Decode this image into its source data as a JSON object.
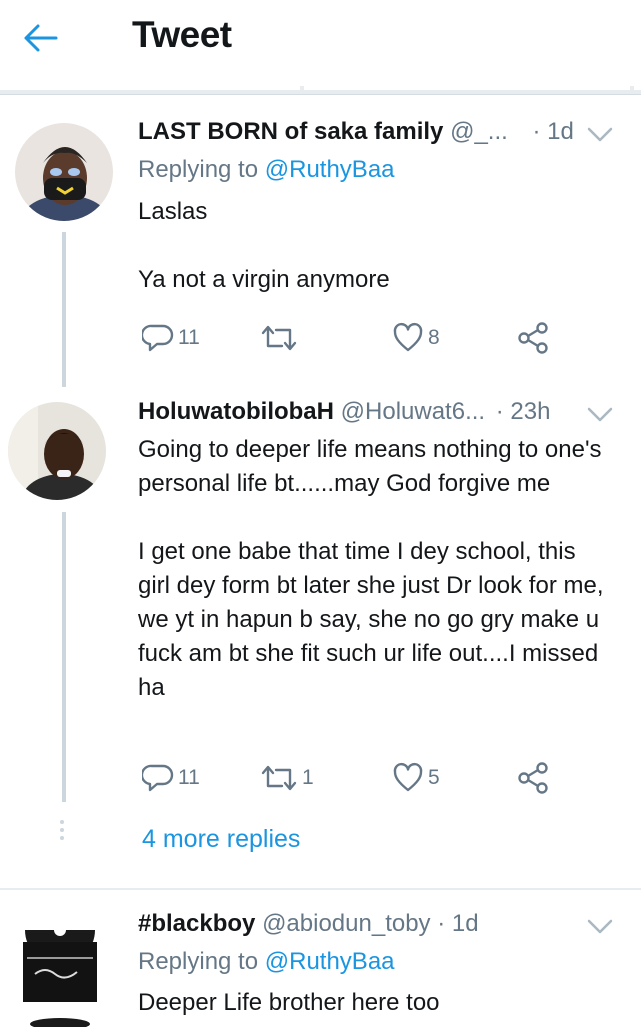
{
  "header": {
    "title": "Tweet"
  },
  "tweets": [
    {
      "name": "LAST BORN of saka family",
      "handle": "@_...",
      "time": "· 1d",
      "replying_prefix": "Replying to ",
      "replying_to": "@RuthyBaa",
      "body": "Laslas\n\nYa not a virgin anymore",
      "replies": "11",
      "retweets": "",
      "likes": "8"
    },
    {
      "name": "HoluwatobilobaH",
      "handle": "@Holuwat6...",
      "time": "· 23h",
      "body": "Going to deeper life means nothing to one's personal life bt......may God forgive me\n\nI get one babe that time I dey school, this girl dey form bt later she just Dr look for me, we yt in hapun b say, she no go gry make u fuck am bt she fit such ur life out....I missed ha",
      "replies": "11",
      "retweets": "1",
      "likes": "5"
    },
    {
      "name": "#blackboy",
      "handle": "@abiodun_toby",
      "time": "· 1d",
      "replying_prefix": "Replying to ",
      "replying_to": "@RuthyBaa",
      "body": "Deeper Life brother here too"
    }
  ],
  "more_replies": "4 more replies",
  "colors": {
    "accent": "#1b95e0",
    "muted": "#657786",
    "text": "#14171a",
    "divider": "#e6ecf0"
  }
}
